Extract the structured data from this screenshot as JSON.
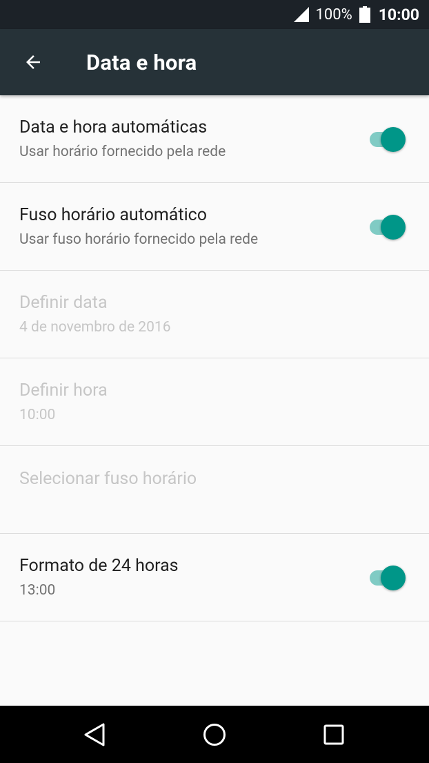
{
  "status_bar": {
    "battery_percent": "100%",
    "time": "10:00",
    "signal_icon": "signal-icon",
    "battery_icon": "battery-icon"
  },
  "app_bar": {
    "title": "Data e hora",
    "back_icon": "arrow-back-icon"
  },
  "settings": [
    {
      "id": "auto-date-time",
      "title": "Data e hora automáticas",
      "subtitle": "Usar horário fornecido pela rede",
      "enabled": true,
      "switch_on": true
    },
    {
      "id": "auto-time-zone",
      "title": "Fuso horário automático",
      "subtitle": "Usar fuso horário fornecido pela rede",
      "enabled": true,
      "switch_on": true
    },
    {
      "id": "set-date",
      "title": "Definir data",
      "subtitle": "4 de novembro de 2016",
      "enabled": false
    },
    {
      "id": "set-time",
      "title": "Definir hora",
      "subtitle": "10:00",
      "enabled": false
    },
    {
      "id": "select-time-zone",
      "title": "Selecionar fuso horário",
      "subtitle": "",
      "enabled": false
    },
    {
      "id": "24-hour-format",
      "title": "Formato de 24 horas",
      "subtitle": "13:00",
      "enabled": true,
      "switch_on": true
    }
  ],
  "colors": {
    "status_bar_bg": "#1c2228",
    "app_bar_bg": "#263238",
    "switch_thumb": "#009688",
    "switch_track": "#80cbc4",
    "disabled_text": "#c6c6c6",
    "background": "#fafafa"
  },
  "nav_bar": {
    "back_icon": "nav-back-icon",
    "home_icon": "nav-home-icon",
    "recents_icon": "nav-recents-icon"
  }
}
